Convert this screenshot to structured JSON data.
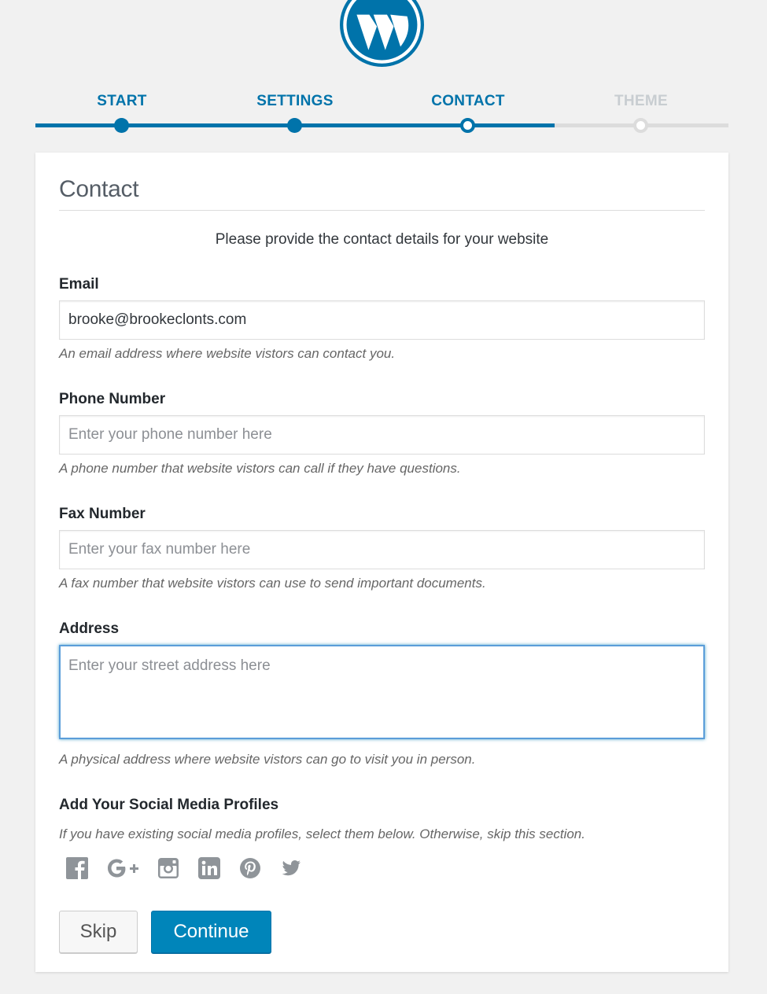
{
  "steps": [
    {
      "label": "START",
      "state": "done"
    },
    {
      "label": "SETTINGS",
      "state": "done"
    },
    {
      "label": "CONTACT",
      "state": "active"
    },
    {
      "label": "THEME",
      "state": "todo"
    }
  ],
  "card": {
    "title": "Contact",
    "intro": "Please provide the contact details for your website"
  },
  "fields": {
    "email": {
      "label": "Email",
      "value": "brooke@brookeclonts.com",
      "help": "An email address where website vistors can contact you."
    },
    "phone": {
      "label": "Phone Number",
      "placeholder": "Enter your phone number here",
      "help": "A phone number that website vistors can call if they have questions."
    },
    "fax": {
      "label": "Fax Number",
      "placeholder": "Enter your fax number here",
      "help": "A fax number that website vistors can use to send important documents."
    },
    "address": {
      "label": "Address",
      "placeholder": "Enter your street address here",
      "help": "A physical address where website vistors can go to visit you in person."
    }
  },
  "social": {
    "label": "Add Your Social Media Profiles",
    "help": "If you have existing social media profiles, select them below. Otherwise, skip this section.",
    "icons": [
      "facebook-icon",
      "google-plus-icon",
      "instagram-icon",
      "linkedin-icon",
      "pinterest-icon",
      "twitter-icon"
    ]
  },
  "buttons": {
    "skip": "Skip",
    "continue": "Continue"
  },
  "colors": {
    "accent": "#0073aa",
    "button_primary": "#0085ba",
    "inactive": "#dcdcdc",
    "icon_gray": "#8f9499"
  }
}
